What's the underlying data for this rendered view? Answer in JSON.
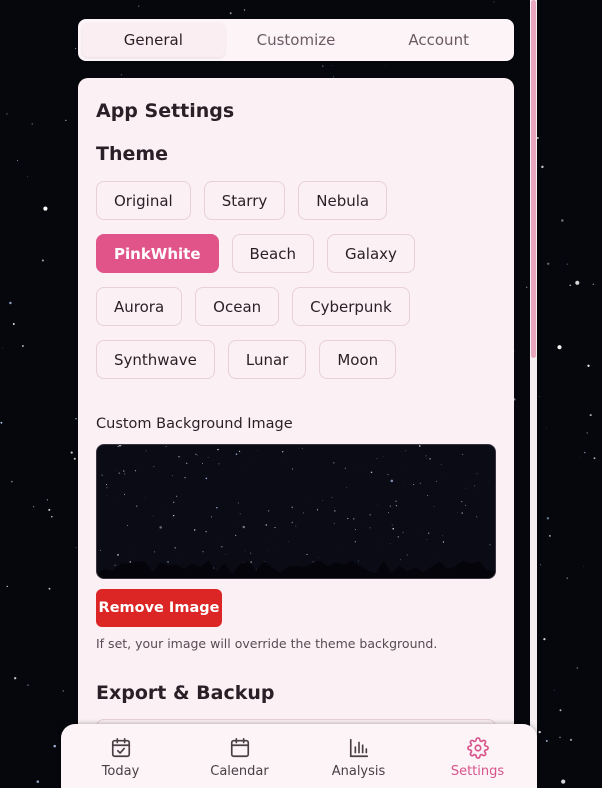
{
  "tabs": [
    {
      "label": "General",
      "active": true
    },
    {
      "label": "Customize",
      "active": false
    },
    {
      "label": "Account",
      "active": false
    }
  ],
  "panel": {
    "title": "App Settings",
    "theme_title": "Theme",
    "themes": [
      {
        "label": "Original",
        "selected": false
      },
      {
        "label": "Starry",
        "selected": false
      },
      {
        "label": "Nebula",
        "selected": false
      },
      {
        "label": "PinkWhite",
        "selected": true
      },
      {
        "label": "Beach",
        "selected": false
      },
      {
        "label": "Galaxy",
        "selected": false
      },
      {
        "label": "Aurora",
        "selected": false
      },
      {
        "label": "Ocean",
        "selected": false
      },
      {
        "label": "Cyberpunk",
        "selected": false
      },
      {
        "label": "Synthwave",
        "selected": false
      },
      {
        "label": "Lunar",
        "selected": false
      },
      {
        "label": "Moon",
        "selected": false
      }
    ],
    "custom_bg_label": "Custom Background Image",
    "remove_image_label": "Remove Image",
    "hint": "If set, your image will override the theme background.",
    "export_title": "Export & Backup"
  },
  "bottom_nav": [
    {
      "label": "Today",
      "icon": "calendar-check-icon",
      "active": false
    },
    {
      "label": "Calendar",
      "icon": "calendar-icon",
      "active": false
    },
    {
      "label": "Analysis",
      "icon": "bar-chart-icon",
      "active": false
    },
    {
      "label": "Settings",
      "icon": "gear-icon",
      "active": true
    }
  ],
  "colors": {
    "accent": "#e0548a",
    "danger": "#dc2626",
    "panel_bg": "#fbf1f4"
  }
}
